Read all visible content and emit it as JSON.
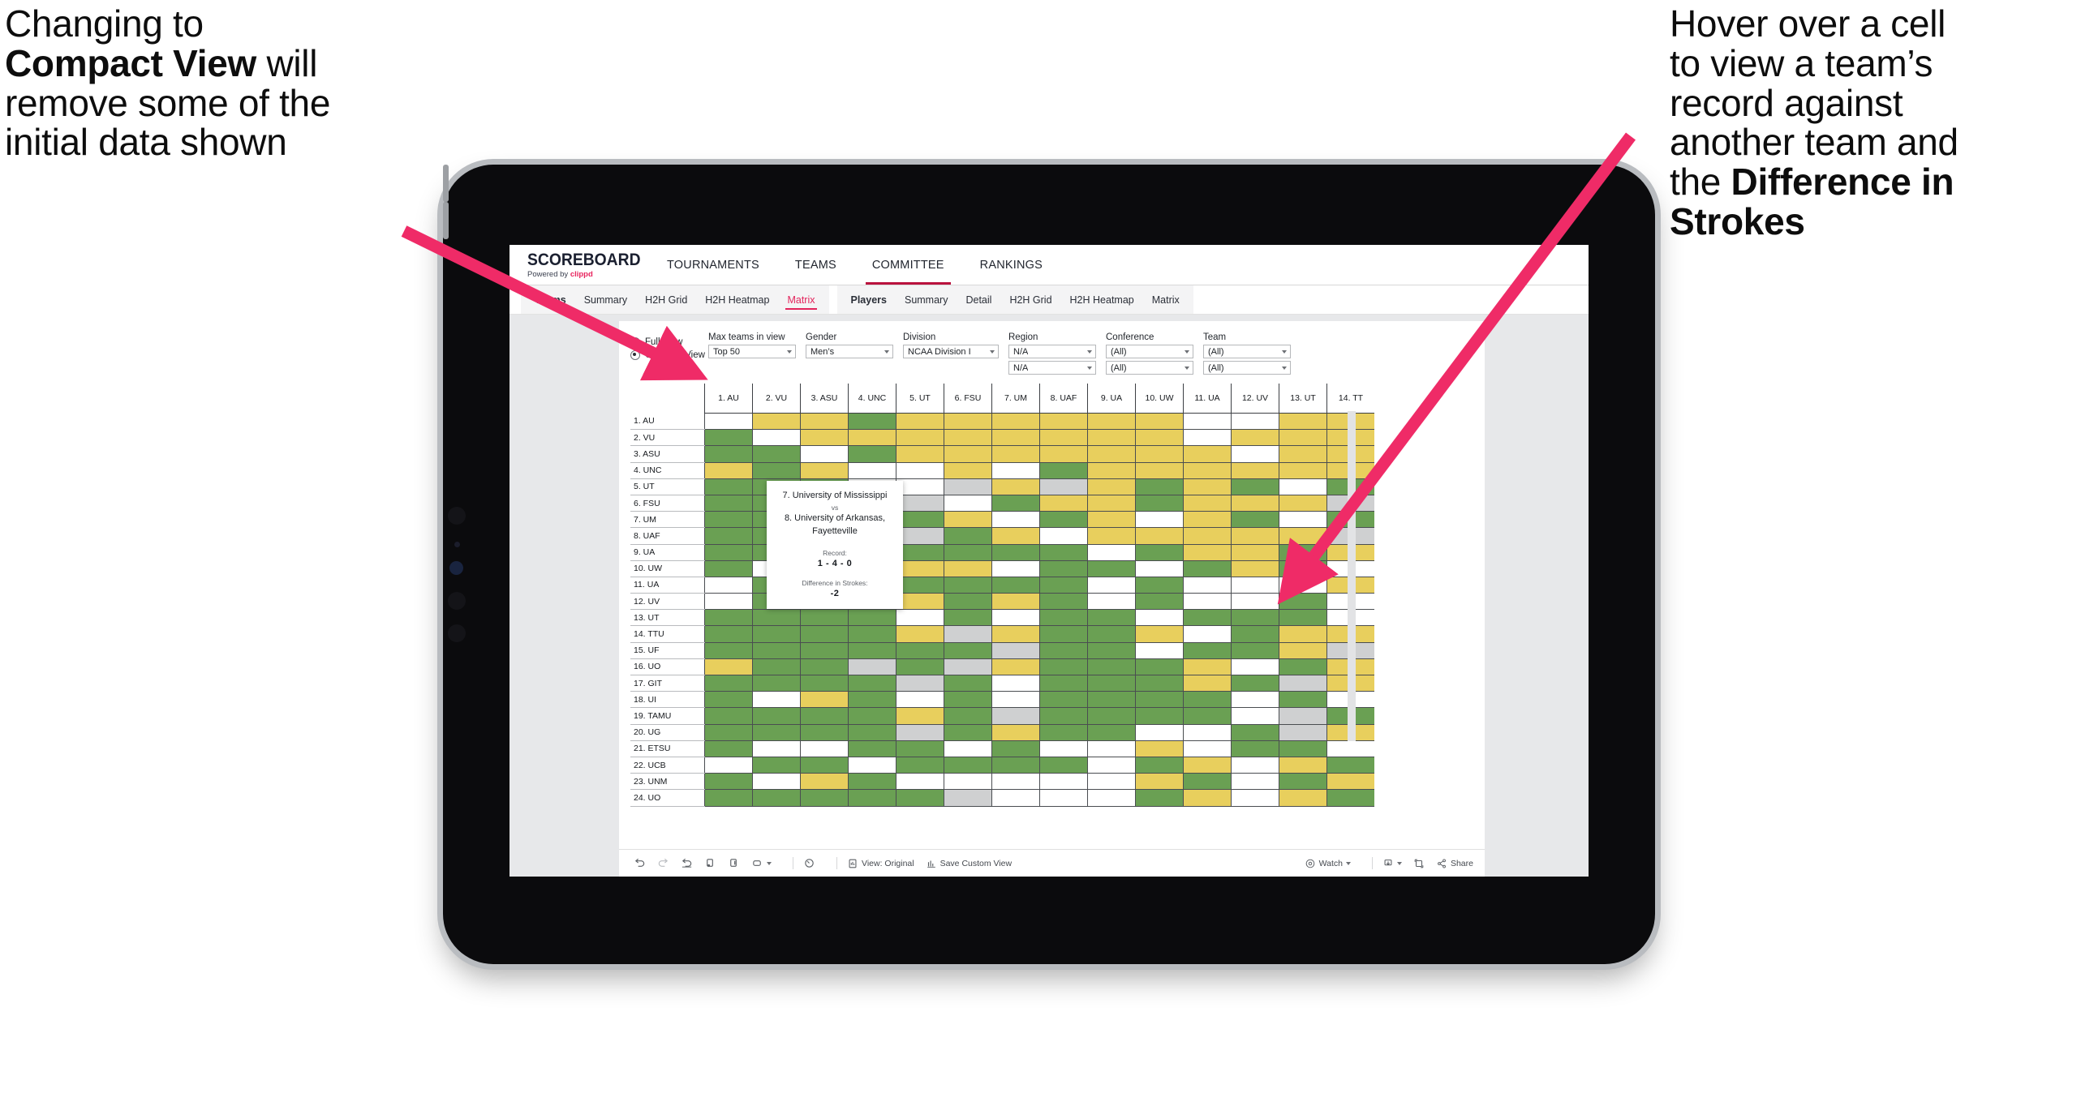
{
  "annotations": {
    "left": {
      "line1": "Changing to",
      "bold": "Compact View",
      "line2": " will",
      "line3": "remove some of the",
      "line4": "initial data shown"
    },
    "right": {
      "line1": "Hover over a cell",
      "line2": "to view a team’s",
      "line3": "record against",
      "line4": "another team and",
      "line5": "the ",
      "bold1": "Difference in",
      "bold2": "Strokes"
    },
    "arrow_color": "#ef2b67"
  },
  "app": {
    "brand": {
      "title": "SCOREBOARD",
      "powered_prefix": "Powered by ",
      "powered_name": "clippd"
    },
    "topnav": [
      {
        "label": "TOURNAMENTS",
        "active": false
      },
      {
        "label": "TEAMS",
        "active": false
      },
      {
        "label": "COMMITTEE",
        "active": true
      },
      {
        "label": "RANKINGS",
        "active": false
      }
    ],
    "subnav_groups": [
      {
        "items": [
          {
            "label": "Teams",
            "head": true,
            "selected": false
          },
          {
            "label": "Summary",
            "head": false,
            "selected": false
          },
          {
            "label": "H2H Grid",
            "head": false,
            "selected": false
          },
          {
            "label": "H2H Heatmap",
            "head": false,
            "selected": false
          },
          {
            "label": "Matrix",
            "head": false,
            "selected": true
          }
        ]
      },
      {
        "items": [
          {
            "label": "Players",
            "head": true,
            "selected": false
          },
          {
            "label": "Summary",
            "head": false,
            "selected": false
          },
          {
            "label": "Detail",
            "head": false,
            "selected": false
          },
          {
            "label": "H2H Grid",
            "head": false,
            "selected": false
          },
          {
            "label": "H2H Heatmap",
            "head": false,
            "selected": false
          },
          {
            "label": "Matrix",
            "head": false,
            "selected": false
          }
        ]
      }
    ],
    "filters": {
      "view_mode": {
        "full_label": "Full View",
        "compact_label": "Compact View",
        "selected": "Compact View"
      },
      "selects": [
        {
          "label": "Max teams in view",
          "value": "Top 50",
          "wide": false,
          "second": null
        },
        {
          "label": "Gender",
          "value": "Men’s",
          "wide": false,
          "second": null
        },
        {
          "label": "Division",
          "value": "NCAA Division I",
          "wide": true,
          "second": null
        },
        {
          "label": "Region",
          "value": "N/A",
          "wide": false,
          "second": "N/A"
        },
        {
          "label": "Conference",
          "value": "(All)",
          "wide": false,
          "second": "(All)"
        },
        {
          "label": "Team",
          "value": "(All)",
          "wide": false,
          "second": "(All)"
        }
      ]
    },
    "toolbar": {
      "view_original": "View: Original",
      "save_custom_view": "Save Custom View",
      "watch": "Watch",
      "share": "Share"
    }
  },
  "tooltip": {
    "team_a": "7. University of Mississippi",
    "vs": "vs",
    "team_b": "8. University of Arkansas, Fayetteville",
    "record_label": "Record:",
    "record_value": "1 - 4 - 0",
    "diff_label": "Difference in Strokes:",
    "diff_value": "-2"
  },
  "matrix": {
    "legend_colors": {
      "win": "#6aa053",
      "loss": "#e8cf5d",
      "tie": "#cfd0d1",
      "none": "#ffffff"
    },
    "columns": [
      "1. AU",
      "2. VU",
      "3. ASU",
      "4. UNC",
      "5. UT",
      "6. FSU",
      "7. UM",
      "8. UAF",
      "9. UA",
      "10. UW",
      "11. UA",
      "12. UV",
      "13. UT",
      "14. TT"
    ],
    "rows": [
      {
        "label": "1. AU",
        "cells": [
          "w",
          "y",
          "y",
          "g",
          "y",
          "y",
          "y",
          "y",
          "y",
          "y",
          "w",
          "w",
          "y",
          "y"
        ]
      },
      {
        "label": "2. VU",
        "cells": [
          "g",
          "w",
          "y",
          "y",
          "y",
          "y",
          "y",
          "y",
          "y",
          "y",
          "w",
          "y",
          "y",
          "y"
        ]
      },
      {
        "label": "3. ASU",
        "cells": [
          "g",
          "g",
          "w",
          "g",
          "y",
          "y",
          "y",
          "y",
          "y",
          "y",
          "y",
          "w",
          "y",
          "y"
        ]
      },
      {
        "label": "4. UNC",
        "cells": [
          "y",
          "g",
          "y",
          "w",
          "w",
          "y",
          "w",
          "g",
          "y",
          "y",
          "y",
          "y",
          "y",
          "y"
        ]
      },
      {
        "label": "5. UT",
        "cells": [
          "g",
          "g",
          "g",
          "w",
          "w",
          "s",
          "y",
          "s",
          "y",
          "g",
          "y",
          "g",
          "w",
          "g"
        ]
      },
      {
        "label": "6. FSU",
        "cells": [
          "g",
          "g",
          "g",
          "g",
          "s",
          "w",
          "g",
          "y",
          "y",
          "g",
          "y",
          "y",
          "y",
          "s"
        ]
      },
      {
        "label": "7. UM",
        "cells": [
          "g",
          "g",
          "g",
          "w",
          "g",
          "y",
          "w",
          "g",
          "y",
          "w",
          "y",
          "g",
          "w",
          "g"
        ]
      },
      {
        "label": "8. UAF",
        "cells": [
          "g",
          "g",
          "g",
          "y",
          "s",
          "g",
          "y",
          "w",
          "y",
          "y",
          "y",
          "y",
          "y",
          "s"
        ]
      },
      {
        "label": "9. UA",
        "cells": [
          "g",
          "g",
          "g",
          "g",
          "g",
          "g",
          "g",
          "g",
          "w",
          "g",
          "y",
          "y",
          "g",
          "y"
        ]
      },
      {
        "label": "10. UW",
        "cells": [
          "g",
          "w",
          "g",
          "g",
          "y",
          "y",
          "w",
          "g",
          "g",
          "w",
          "g",
          "y",
          "g",
          "w"
        ]
      },
      {
        "label": "11. UA",
        "cells": [
          "w",
          "g",
          "g",
          "g",
          "g",
          "g",
          "g",
          "g",
          "w",
          "g",
          "w",
          "w",
          "w",
          "y"
        ]
      },
      {
        "label": "12. UV",
        "cells": [
          "w",
          "g",
          "w",
          "g",
          "y",
          "g",
          "y",
          "g",
          "w",
          "g",
          "w",
          "w",
          "g",
          "w"
        ]
      },
      {
        "label": "13. UT",
        "cells": [
          "g",
          "g",
          "g",
          "g",
          "w",
          "g",
          "w",
          "g",
          "g",
          "w",
          "g",
          "g",
          "g",
          "w"
        ]
      },
      {
        "label": "14. TTU",
        "cells": [
          "g",
          "g",
          "g",
          "g",
          "y",
          "s",
          "y",
          "g",
          "g",
          "y",
          "w",
          "g",
          "y",
          "y"
        ]
      },
      {
        "label": "15. UF",
        "cells": [
          "g",
          "g",
          "g",
          "g",
          "g",
          "g",
          "s",
          "g",
          "g",
          "w",
          "g",
          "g",
          "y",
          "s"
        ]
      },
      {
        "label": "16. UO",
        "cells": [
          "y",
          "g",
          "g",
          "s",
          "g",
          "s",
          "y",
          "g",
          "g",
          "g",
          "y",
          "w",
          "g",
          "y"
        ]
      },
      {
        "label": "17. GIT",
        "cells": [
          "g",
          "g",
          "g",
          "g",
          "s",
          "g",
          "w",
          "g",
          "g",
          "g",
          "y",
          "g",
          "s",
          "y"
        ]
      },
      {
        "label": "18. UI",
        "cells": [
          "g",
          "w",
          "y",
          "g",
          "w",
          "g",
          "w",
          "g",
          "g",
          "g",
          "g",
          "w",
          "g",
          "w"
        ]
      },
      {
        "label": "19. TAMU",
        "cells": [
          "g",
          "g",
          "g",
          "g",
          "y",
          "g",
          "s",
          "g",
          "g",
          "g",
          "g",
          "w",
          "s",
          "g"
        ]
      },
      {
        "label": "20. UG",
        "cells": [
          "g",
          "g",
          "g",
          "g",
          "s",
          "g",
          "y",
          "g",
          "g",
          "w",
          "w",
          "g",
          "s",
          "y"
        ]
      },
      {
        "label": "21. ETSU",
        "cells": [
          "g",
          "w",
          "w",
          "g",
          "g",
          "w",
          "g",
          "w",
          "w",
          "y",
          "w",
          "g",
          "g",
          "w"
        ]
      },
      {
        "label": "22. UCB",
        "cells": [
          "w",
          "g",
          "g",
          "w",
          "g",
          "g",
          "g",
          "g",
          "w",
          "g",
          "y",
          "w",
          "y",
          "g"
        ]
      },
      {
        "label": "23. UNM",
        "cells": [
          "g",
          "w",
          "y",
          "g",
          "w",
          "w",
          "w",
          "w",
          "w",
          "y",
          "g",
          "w",
          "g",
          "y"
        ]
      },
      {
        "label": "24. UO",
        "cells": [
          "g",
          "g",
          "g",
          "g",
          "g",
          "s",
          "w",
          "w",
          "w",
          "g",
          "y",
          "w",
          "y",
          "g"
        ]
      }
    ]
  }
}
